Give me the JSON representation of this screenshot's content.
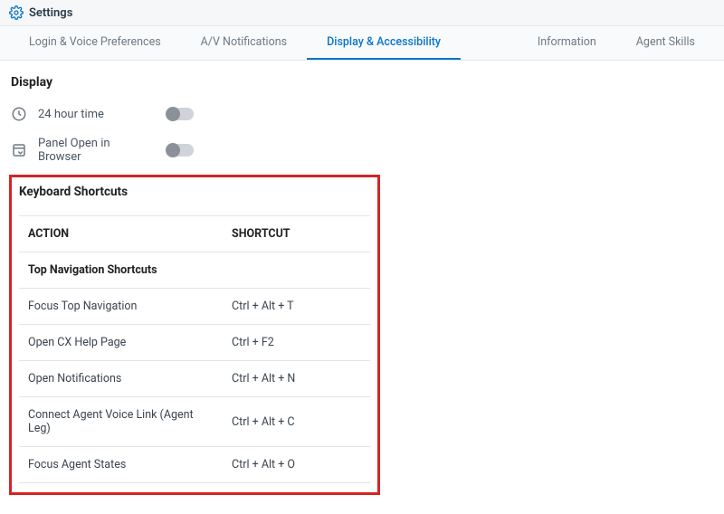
{
  "header": {
    "title": "Settings"
  },
  "tabs": {
    "items": [
      {
        "label": "Login & Voice Preferences"
      },
      {
        "label": "A/V Notifications"
      },
      {
        "label": "Display & Accessibility"
      },
      {
        "label": "Information"
      },
      {
        "label": "Agent Skills"
      }
    ],
    "active_index": 2
  },
  "display_section": {
    "title": "Display",
    "rows": [
      {
        "label": "24 hour time"
      },
      {
        "label": "Panel Open in Browser"
      }
    ]
  },
  "shortcuts_section": {
    "title": "Keyboard Shortcuts",
    "columns": {
      "action": "ACTION",
      "shortcut": "SHORTCUT"
    },
    "group_label": "Top Navigation Shortcuts",
    "rows": [
      {
        "action": "Focus Top Navigation",
        "shortcut": "Ctrl + Alt + T"
      },
      {
        "action": "Open CX Help Page",
        "shortcut": "Ctrl + F2"
      },
      {
        "action": "Open Notifications",
        "shortcut": "Ctrl + Alt + N"
      },
      {
        "action": "Connect Agent Voice Link (Agent Leg)",
        "shortcut": "Ctrl + Alt + C"
      },
      {
        "action": "Focus Agent States",
        "shortcut": "Ctrl + Alt + O"
      }
    ]
  }
}
